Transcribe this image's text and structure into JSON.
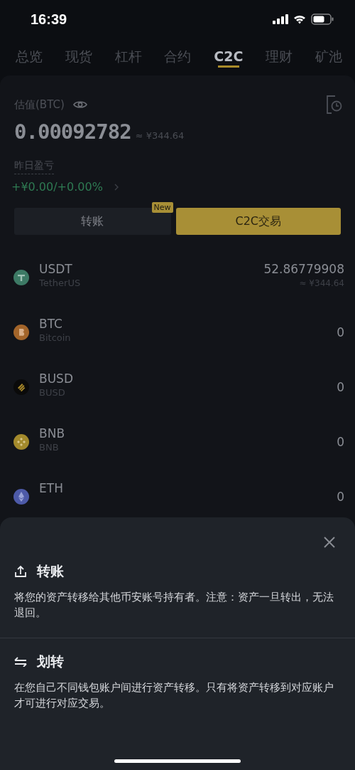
{
  "status_bar": {
    "time": "16:39"
  },
  "tabs": [
    {
      "label": "总览",
      "selected": false
    },
    {
      "label": "现货",
      "selected": false
    },
    {
      "label": "杠杆",
      "selected": false
    },
    {
      "label": "合约",
      "selected": false
    },
    {
      "label": "C2C",
      "selected": true
    },
    {
      "label": "理财",
      "selected": false
    },
    {
      "label": "矿池",
      "selected": false
    }
  ],
  "summary": {
    "label": "估值(BTC)",
    "value": "0.00092782",
    "fiat": "≈ ¥344.64",
    "pnl_label": "昨日盈亏",
    "pnl": "+¥0.00/+0.00%"
  },
  "actions": [
    {
      "label": "转账",
      "badge": "New",
      "kind": "secondary"
    },
    {
      "label": "C2C交易",
      "kind": "primary"
    }
  ],
  "assets": [
    {
      "symbol": "USDT",
      "name": "TetherUS",
      "amount": "52.86779908",
      "fiat": "≈ ¥344.64",
      "kind": "usdt"
    },
    {
      "symbol": "BTC",
      "name": "Bitcoin",
      "amount": "0",
      "kind": "btc"
    },
    {
      "symbol": "BUSD",
      "name": "BUSD",
      "amount": "0",
      "kind": "busd"
    },
    {
      "symbol": "BNB",
      "name": "BNB",
      "amount": "0",
      "kind": "bnb"
    },
    {
      "symbol": "ETH",
      "amount": "0",
      "kind": "eth"
    }
  ],
  "sheet": {
    "options": [
      {
        "title": "转账",
        "description": "将您的资产转移给其他币安账号持有者。注意：资产一旦转出，无法退回。",
        "kind": "upload"
      },
      {
        "title": "划转",
        "description": "在您自己不同钱包账户间进行资产转移。只有将资产转移到对应账户才可进行对应交易。",
        "kind": "swap"
      }
    ]
  }
}
